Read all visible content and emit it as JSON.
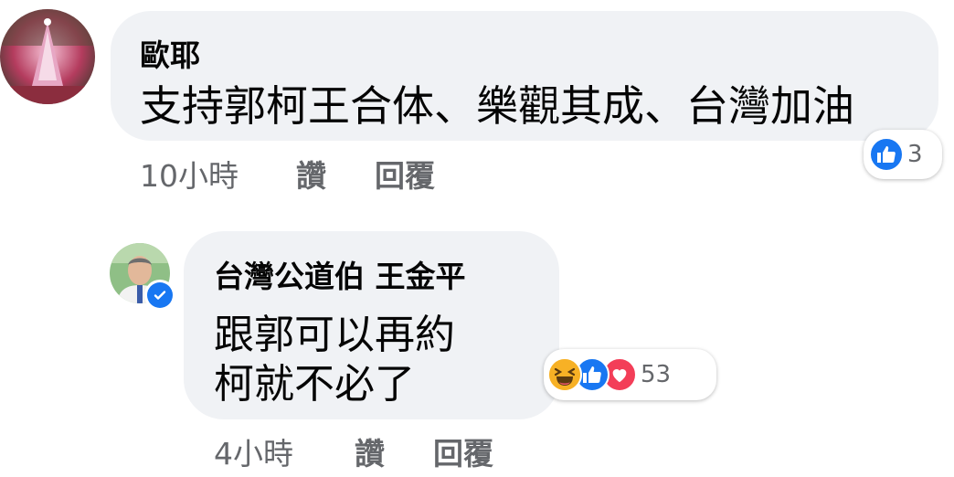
{
  "colors": {
    "bubble": "#f0f2f5",
    "text": "#050505",
    "meta": "#65676b",
    "like_blue": "#1877f2",
    "love_red": "#f33e58",
    "haha_yellow": "#f7b125"
  },
  "comments": [
    {
      "author": "歐耶",
      "lines": [
        "支持郭柯王合体、樂觀其成、台灣加油"
      ],
      "time": "10小時",
      "like_label": "讚",
      "reply_label": "回覆",
      "reactions": {
        "icons": [
          "like-icon"
        ],
        "count": "3"
      }
    },
    {
      "author": "台灣公道伯 王金平",
      "verified": true,
      "lines": [
        "跟郭可以再約",
        "柯就不必了"
      ],
      "time": "4小時",
      "like_label": "讚",
      "reply_label": "回覆",
      "reactions": {
        "icons": [
          "haha-icon",
          "like-icon",
          "love-icon"
        ],
        "count": "53"
      }
    }
  ]
}
